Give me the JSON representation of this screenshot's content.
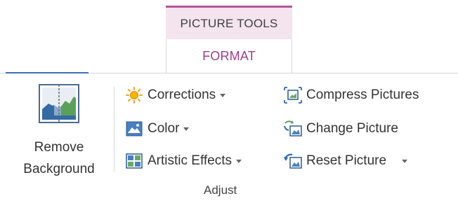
{
  "contextual_tab": {
    "group_title": "PICTURE TOOLS",
    "tab_label": "FORMAT"
  },
  "adjust_group": {
    "label": "Adjust",
    "remove_background": {
      "line1": "Remove",
      "line2": "Background",
      "icon": "remove-background-icon"
    },
    "left_column": [
      {
        "label": "Corrections",
        "icon": "sun-icon",
        "dropdown": true
      },
      {
        "label": "Color",
        "icon": "color-icon",
        "dropdown": true
      },
      {
        "label": "Artistic Effects",
        "icon": "artistic-effects-icon",
        "dropdown": true
      }
    ],
    "right_column": [
      {
        "label": "Compress Pictures",
        "icon": "compress-pictures-icon",
        "dropdown": false
      },
      {
        "label": "Change Picture",
        "icon": "change-picture-icon",
        "dropdown": false
      },
      {
        "label": "Reset Picture",
        "icon": "reset-picture-icon",
        "dropdown": true
      }
    ]
  },
  "colors": {
    "accent": "#a03e8a",
    "contextual_bg": "#f3e4ee",
    "contextual_border": "#b4539b",
    "tab_underline": "#3f6fb7"
  }
}
